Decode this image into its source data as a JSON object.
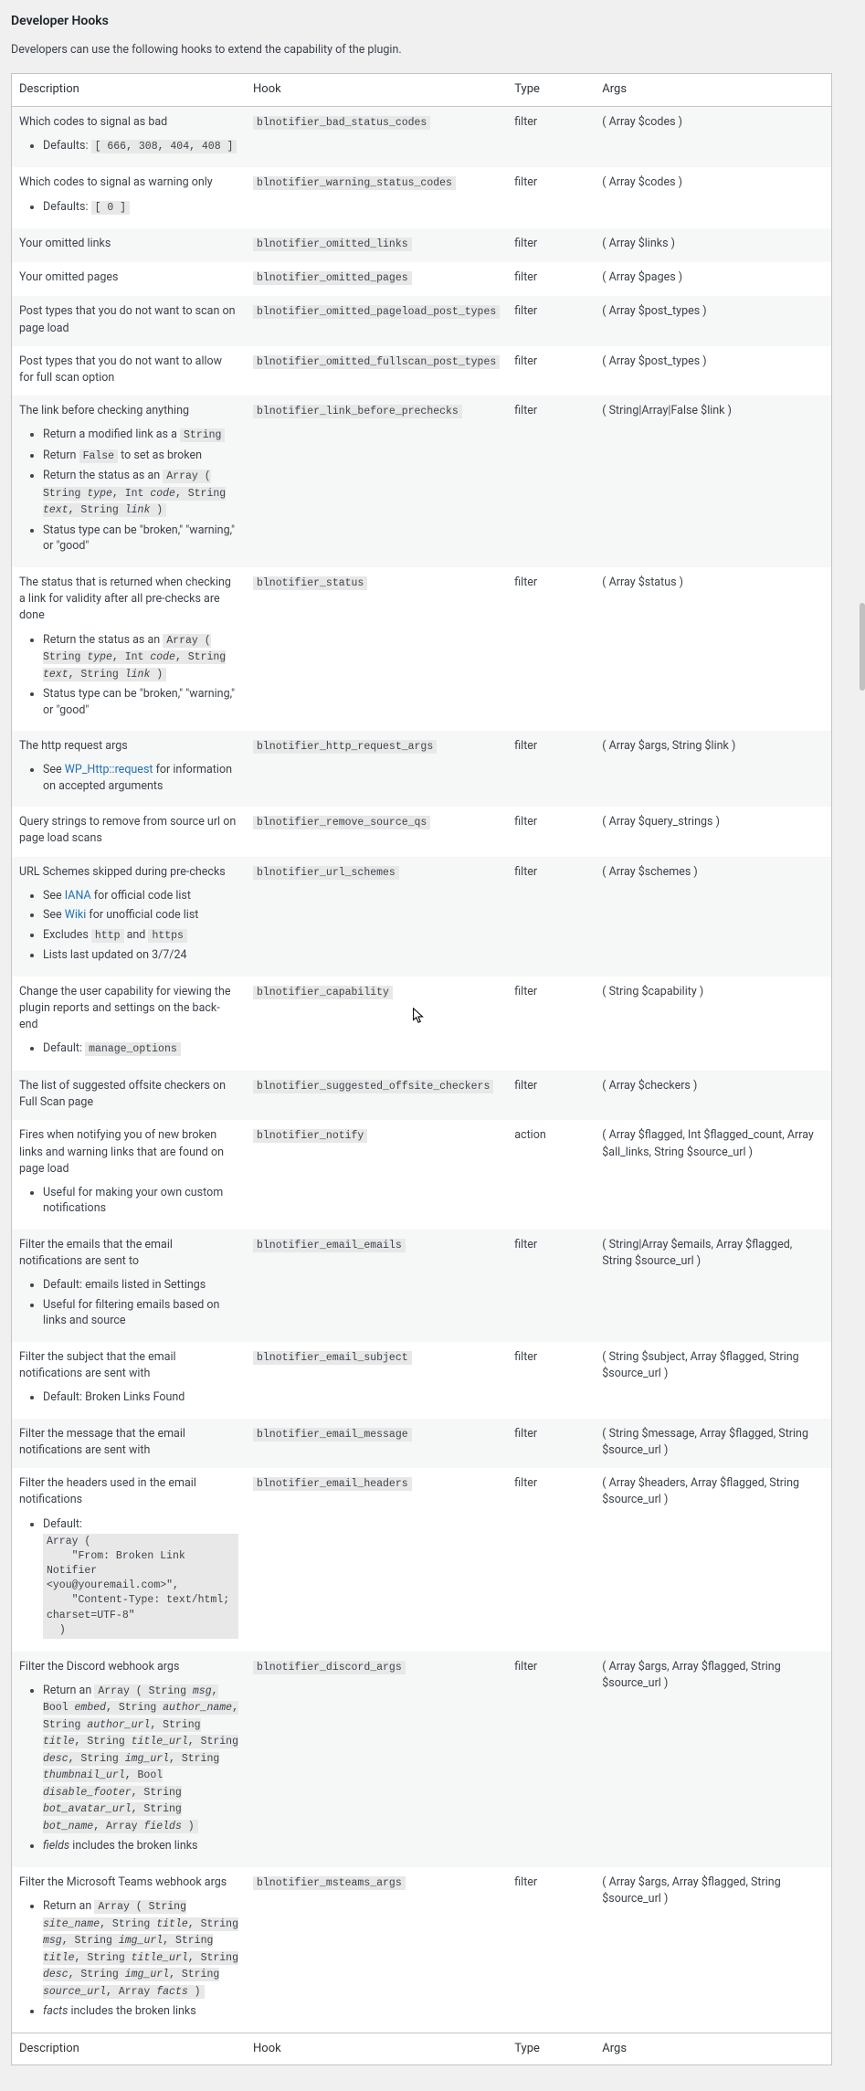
{
  "heading": "Developer Hooks",
  "intro": "Developers can use the following hooks to extend the capability of the plugin.",
  "columns": {
    "desc": "Description",
    "hook": "Hook",
    "type": "Type",
    "args": "Args"
  },
  "footer": {
    "desc": "Description",
    "hook": "Hook",
    "type": "Type",
    "args": "Args"
  },
  "type_filter": "filter",
  "type_action": "action",
  "rows": {
    "r1": {
      "desc": "Which codes to signal as bad",
      "hook": "blnotifier_bad_status_codes",
      "args": "( Array $codes )",
      "li1_a": "Defaults: ",
      "li1_b": "[ 666, 308, 404, 408 ]"
    },
    "r2": {
      "desc": "Which codes to signal as warning only",
      "hook": "blnotifier_warning_status_codes",
      "args": "( Array $codes )",
      "li1_a": "Defaults: ",
      "li1_b": "[ 0 ]"
    },
    "r3": {
      "desc": "Your omitted links",
      "hook": "blnotifier_omitted_links",
      "args": "( Array $links )"
    },
    "r4": {
      "desc": "Your omitted pages",
      "hook": "blnotifier_omitted_pages",
      "args": "( Array $pages )"
    },
    "r5": {
      "desc": "Post types that you do not want to scan on page load",
      "hook": "blnotifier_omitted_pageload_post_types",
      "args": "( Array $post_types )"
    },
    "r6": {
      "desc": "Post types that you do not want to allow for full scan option",
      "hook": "blnotifier_omitted_fullscan_post_types",
      "args": "( Array $post_types )"
    },
    "r7": {
      "desc": "The link before checking anything",
      "hook": "blnotifier_link_before_prechecks",
      "args": "( String|Array|False $link )",
      "li1_a": "Return a modified link as a ",
      "li1_b": "String",
      "li2_a": "Return ",
      "li2_b": "False",
      "li2_c": " to set as broken",
      "li3_a": "Return the status as an ",
      "li3_b": "Array ( String ",
      "li3_c": "type",
      "li3_d": ", Int ",
      "li3_e": "code",
      "li3_f": ", String ",
      "li3_g": "text",
      "li3_h": ", String ",
      "li3_i": "link",
      "li3_j": " )",
      "li4": "Status type can be \"broken,\" \"warning,\" or \"good\""
    },
    "r8": {
      "desc": "The status that is returned when checking a link for validity after all pre-checks are done",
      "hook": "blnotifier_status",
      "args": "( Array $status )",
      "li1_a": "Return the status as an ",
      "li1_b": "Array ( String ",
      "li1_c": "type",
      "li1_d": ", Int ",
      "li1_e": "code",
      "li1_f": ", String ",
      "li1_g": "text",
      "li1_h": ", String ",
      "li1_i": "link",
      "li1_j": " )",
      "li2": "Status type can be \"broken,\" \"warning,\" or \"good\""
    },
    "r9": {
      "desc": "The http request args",
      "hook": "blnotifier_http_request_args",
      "args": "( Array $args, String $link )",
      "li1_a": "See ",
      "li1_link": "WP_Http::request",
      "li1_b": " for information on accepted arguments"
    },
    "r10": {
      "desc": "Query strings to remove from source url on page load scans",
      "hook": "blnotifier_remove_source_qs",
      "args": "( Array $query_strings )"
    },
    "r11": {
      "desc": "URL Schemes skipped during pre-checks",
      "hook": "blnotifier_url_schemes",
      "args": "( Array $schemes )",
      "li1_a": "See ",
      "li1_link": "IANA",
      "li1_b": " for official code list",
      "li2_a": "See ",
      "li2_link": "Wiki",
      "li2_b": " for unofficial code list",
      "li3_a": "Excludes ",
      "li3_b": "http",
      "li3_c": " and ",
      "li3_d": "https",
      "li4": "Lists last updated on 3/7/24"
    },
    "r12": {
      "desc": "Change the user capability for viewing the plugin reports and settings on the back-end",
      "hook": "blnotifier_capability",
      "args": "( String $capability )",
      "li1_a": "Default: ",
      "li1_b": "manage_options"
    },
    "r13": {
      "desc": "The list of suggested offsite checkers on Full Scan page",
      "hook": "blnotifier_suggested_offsite_checkers",
      "args": "( Array $checkers )"
    },
    "r14": {
      "desc": "Fires when notifying you of new broken links and warning links that are found on page load",
      "hook": "blnotifier_notify",
      "args": "( Array $flagged, Int $flagged_count, Array $all_links, String $source_url )",
      "li1": "Useful for making your own custom notifications"
    },
    "r15": {
      "desc": "Filter the emails that the email notifications are sent to",
      "hook": "blnotifier_email_emails",
      "args": "( String|Array $emails, Array $flagged, String $source_url )",
      "li1": "Default: emails listed in Settings",
      "li2": "Useful for filtering emails based on links and source"
    },
    "r16": {
      "desc": "Filter the subject that the email notifications are sent with",
      "hook": "blnotifier_email_subject",
      "args": "( String $subject, Array $flagged, String $source_url )",
      "li1": "Default: Broken Links Found"
    },
    "r17": {
      "desc": "Filter the message that the email notifications are sent with",
      "hook": "blnotifier_email_message",
      "args": "( String $message, Array $flagged, String $source_url )"
    },
    "r18": {
      "desc": "Filter the headers used in the email notifications",
      "hook": "blnotifier_email_headers",
      "args": "( Array $headers, Array $flagged, String $source_url )",
      "li1_a": "Default:",
      "li1_code": "Array (\n    \"From: Broken Link Notifier <you@youremail.com>\",\n    \"Content-Type: text/html; charset=UTF-8\"\n  )"
    },
    "r19": {
      "desc": "Filter the Discord webhook args",
      "hook": "blnotifier_discord_args",
      "args": "( Array $args, Array $flagged, String $source_url )",
      "li1_a": "Return an ",
      "li1_b": "Array ( String ",
      "li1_c": "msg",
      "li1_d": ", Bool ",
      "li1_e": "embed",
      "li1_f": ", String ",
      "li1_g": "author_name",
      "li1_h": ", String ",
      "li1_i": "author_url",
      "li1_j": ", String ",
      "li1_k": "title",
      "li1_l": ", String ",
      "li1_m": "title_url",
      "li1_n": ", String ",
      "li1_o": "desc",
      "li1_p": ", String ",
      "li1_q": "img_url",
      "li1_r": ", String ",
      "li1_s": "thumbnail_url",
      "li1_t": ", Bool ",
      "li1_u": "disable_footer",
      "li1_v": ", String ",
      "li1_w": "bot_avatar_url",
      "li1_x": ", String ",
      "li1_y": "bot_name",
      "li1_z": ", Array ",
      "li1_aa": "fields",
      "li1_ab": " )",
      "li2_a": "fields",
      "li2_b": " includes the broken links"
    },
    "r20": {
      "desc": "Filter the Microsoft Teams webhook args",
      "hook": "blnotifier_msteams_args",
      "args": "( Array $args, Array $flagged, String $source_url )",
      "li1_a": "Return an ",
      "li1_b": "Array ( String ",
      "li1_c": "site_name",
      "li1_d": ", String ",
      "li1_e": "title",
      "li1_f": ", String ",
      "li1_g": "msg",
      "li1_h": ", String ",
      "li1_i": "img_url",
      "li1_j": ", String ",
      "li1_k": "title",
      "li1_l": ", String ",
      "li1_m": "title_url",
      "li1_n": ", String ",
      "li1_o": "desc",
      "li1_p": ", String ",
      "li1_q": "img_url",
      "li1_r": ", String ",
      "li1_s": "source_url",
      "li1_t": ", Array ",
      "li1_u": "facts",
      "li1_v": " )",
      "li2_a": "facts",
      "li2_b": " includes the broken links"
    }
  }
}
